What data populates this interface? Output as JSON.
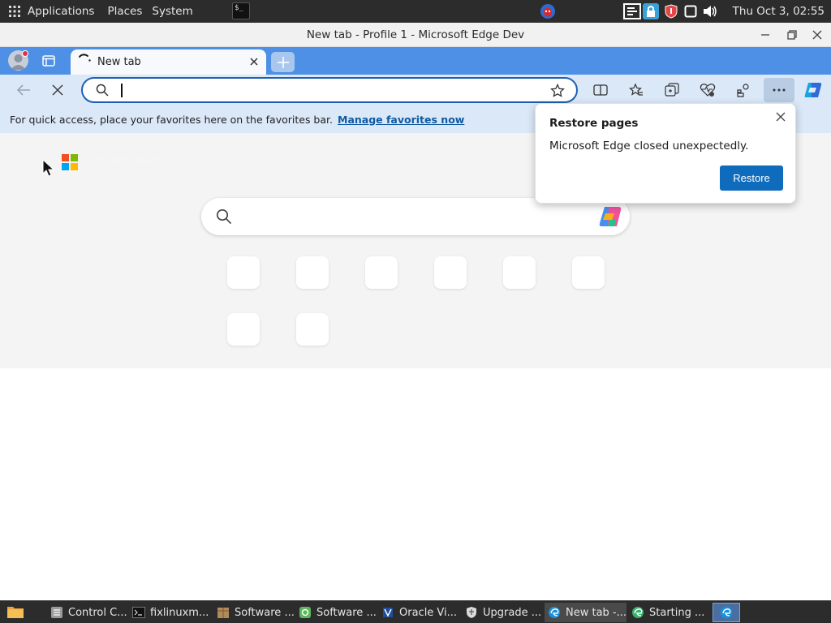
{
  "top_panel": {
    "menus": [
      "Applications",
      "Places",
      "System"
    ],
    "clock": "Thu Oct  3, 02:55",
    "tray_icons": [
      "bug-icon",
      "network-icon",
      "lock-icon",
      "shield-icon",
      "window-icon",
      "volume-icon"
    ]
  },
  "window": {
    "title": "New tab - Profile 1 - Microsoft Edge Dev"
  },
  "tabs": [
    {
      "label": "New tab",
      "loading": true
    }
  ],
  "address_bar": {
    "value": "",
    "placeholder": ""
  },
  "favorites_bar": {
    "hint": "For quick access, place your favorites here on the favorites bar.",
    "link": "Manage favorites now"
  },
  "newtab": {
    "brand": "Microsoft Start",
    "search_placeholder": "",
    "quicklink_count": 8
  },
  "restore_popup": {
    "title": "Restore pages",
    "message": "Microsoft Edge closed unexpectedly.",
    "button": "Restore"
  },
  "taskbar": {
    "items": [
      {
        "label": "Control C...",
        "icon": "control-center-icon"
      },
      {
        "label": "fixlinuxm...",
        "icon": "terminal-icon"
      },
      {
        "label": "Software ...",
        "icon": "package-icon"
      },
      {
        "label": "Software ...",
        "icon": "software-icon"
      },
      {
        "label": "Oracle Vi...",
        "icon": "virtualbox-icon"
      },
      {
        "label": "Upgrade ...",
        "icon": "shield-icon"
      },
      {
        "label": "New tab -...",
        "icon": "edge-icon"
      },
      {
        "label": "Starting ...",
        "icon": "edge-icon"
      }
    ]
  },
  "colors": {
    "accent": "#0f6cbd",
    "tabstrip": "#4d90e5",
    "toolbar": "#dbe8f8",
    "panel": "#2c2c2c"
  }
}
